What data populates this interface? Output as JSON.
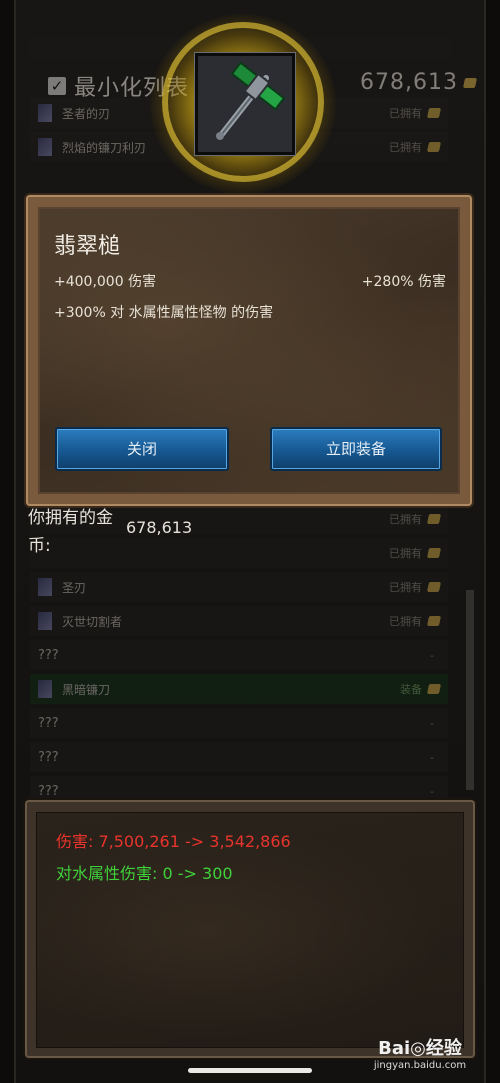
{
  "background": {
    "minimize_label": "最小化列表",
    "top_gold": "678,613",
    "upper_rows": [
      {
        "name": "圣者的刃",
        "status": "已拥有"
      },
      {
        "name": "烈焰的镰刀利刃",
        "status": "已拥有"
      }
    ],
    "lower_rows": [
      {
        "name": "",
        "status": "已拥有",
        "qm": ""
      },
      {
        "name": "",
        "status": "已拥有",
        "qm": ""
      },
      {
        "name": "圣刃",
        "status": "已拥有",
        "qm": ""
      },
      {
        "name": "灭世切割者",
        "status": "已拥有",
        "qm": ""
      },
      {
        "name": "",
        "status": "-",
        "qm": "???"
      },
      {
        "name": "黑暗镰刀",
        "status": "装备",
        "qm": "",
        "equipped": true
      },
      {
        "name": "",
        "status": "-",
        "qm": "???"
      },
      {
        "name": "",
        "status": "-",
        "qm": "???"
      },
      {
        "name": "",
        "status": "-",
        "qm": "???"
      }
    ]
  },
  "owned": {
    "label": "你拥有的金币:",
    "value": "678,613"
  },
  "item": {
    "icon": "emerald-hammer-icon"
  },
  "dialog": {
    "title": "翡翠槌",
    "damage": "+400,000 伤害",
    "damage_pct": "+280% 伤害",
    "element_bonus": "+300% 对 水属性属性怪物 的伤害",
    "close_label": "关闭",
    "equip_label": "立即装备"
  },
  "comparison": {
    "damage": "伤害: 7,500,261 -> 3,542,866",
    "element_damage": "对水属性伤害: 0 -> 300"
  },
  "watermark": {
    "text": "Bai◎经验",
    "url": "jingyan.baidu.com"
  },
  "colors": {
    "accent_blue": "#165891",
    "damage_red": "#e8342c",
    "element_green": "#3fd13a",
    "glow_yellow": "#ffe650"
  }
}
